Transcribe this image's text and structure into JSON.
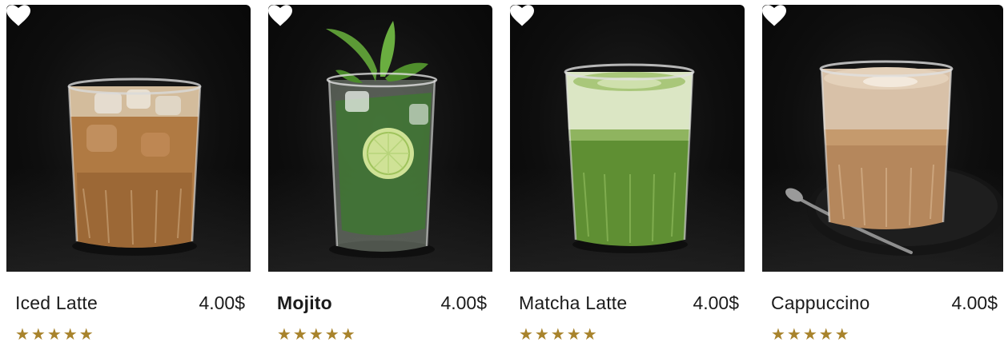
{
  "products": [
    {
      "name": "Iced Latte",
      "price": "4.00$",
      "rating": 5,
      "stars": "★★★★★",
      "favorite_icon": "heart-icon"
    },
    {
      "name": "Mojito",
      "price": "4.00$",
      "rating": 5,
      "stars": "★★★★★",
      "favorite_icon": "heart-icon"
    },
    {
      "name": "Matcha Latte",
      "price": "4.00$",
      "rating": 5,
      "stars": "★★★★★",
      "favorite_icon": "heart-icon"
    },
    {
      "name": "Cappuccino",
      "price": "4.00$",
      "rating": 5,
      "stars": "★★★★★",
      "favorite_icon": "heart-icon"
    }
  ],
  "colors": {
    "star": "#a8832c",
    "photo_background": "#0e0e0e",
    "heart": "#ffffff",
    "text": "#1b1b1b"
  }
}
